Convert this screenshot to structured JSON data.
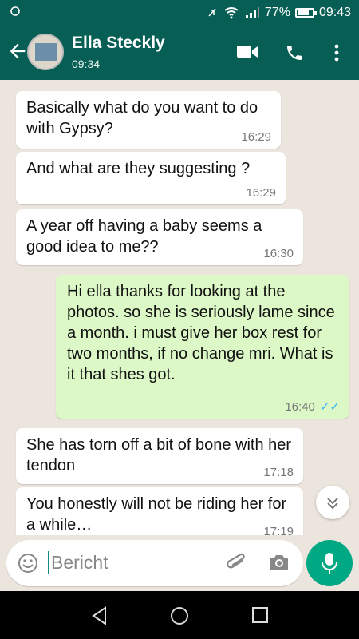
{
  "status_bar": {
    "battery_percent_label": "77%",
    "battery_level": 0.77,
    "time": "09:43"
  },
  "header": {
    "contact_name": "Ella Steckly",
    "last_seen": "09:34"
  },
  "messages": [
    {
      "direction": "in",
      "text": "Basically what do you want to do with Gypsy?",
      "time": "16:29"
    },
    {
      "direction": "in",
      "text": "And what are they suggesting ?",
      "time": "16:29"
    },
    {
      "direction": "in",
      "text": "A year off having a baby seems a good idea to me??",
      "time": "16:30"
    },
    {
      "direction": "out",
      "text": "Hi ella thanks for looking at the photos. so she is seriously lame since a month. i must give her box rest for two months, if no change mri. What is it that shes got.",
      "time": "16:40",
      "read_ticks": "✓✓"
    },
    {
      "direction": "in",
      "text": "She has torn off a bit of bone with her tendon",
      "time": "17:18"
    },
    {
      "direction": "in",
      "text": "You honestly will not be riding her for a while…",
      "time": "17:19"
    }
  ],
  "composer": {
    "placeholder": "Bericht"
  },
  "colors": {
    "header": "#075e54",
    "outgoing_bubble": "#dcf8c6",
    "accent": "#00a884",
    "chat_bg": "#ece5dd"
  },
  "icons": [
    "back-arrow-icon",
    "video-call-icon",
    "phone-icon",
    "more-vert-icon",
    "emoji-icon",
    "attach-icon",
    "camera-icon",
    "mic-icon",
    "scroll-down-icon",
    "nav-back-icon",
    "nav-home-icon",
    "nav-recents-icon"
  ]
}
